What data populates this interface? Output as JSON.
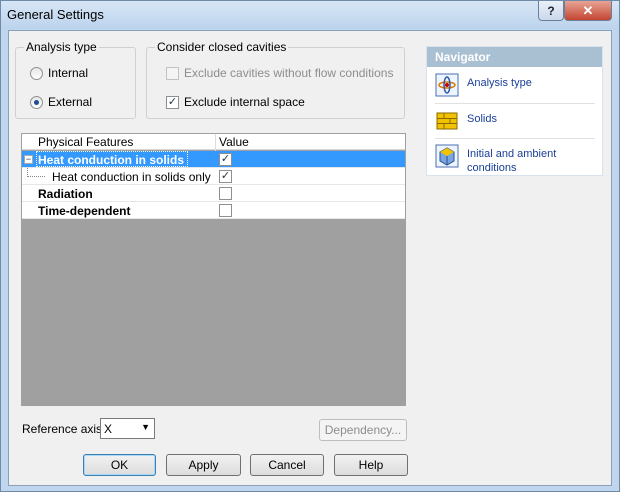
{
  "window": {
    "title": "General Settings"
  },
  "titlebar": {
    "help_label": "?",
    "close_label": "✕"
  },
  "analysis_type": {
    "title": "Analysis type",
    "options": [
      {
        "label": "Internal",
        "selected": false
      },
      {
        "label": "External",
        "selected": true
      }
    ]
  },
  "cavities": {
    "title": "Consider closed cavities",
    "exclude_no_flow": {
      "label": "Exclude cavities without flow conditions",
      "checked": false,
      "enabled": false
    },
    "exclude_internal": {
      "label": "Exclude internal space",
      "checked": true,
      "enabled": true
    }
  },
  "grid": {
    "headers": [
      "Physical Features",
      "Value"
    ],
    "rows": [
      {
        "label": "Heat conduction in solids",
        "checked": true,
        "bold": true,
        "selected": true,
        "expander": "−"
      },
      {
        "label": "Heat conduction in solids only",
        "checked": true,
        "bold": false,
        "selected": false
      },
      {
        "label": "Radiation",
        "checked": false,
        "bold": true,
        "selected": false
      },
      {
        "label": "Time-dependent",
        "checked": false,
        "bold": true,
        "selected": false
      }
    ]
  },
  "reference_axis": {
    "label": "Reference axis:",
    "value": "X"
  },
  "dependency_button": "Dependency...",
  "buttons": {
    "ok": "OK",
    "apply": "Apply",
    "cancel": "Cancel",
    "help": "Help"
  },
  "navigator": {
    "title": "Navigator",
    "items": [
      {
        "label": "Analysis type",
        "icon": "analysis-type-icon"
      },
      {
        "label": "Solids",
        "icon": "solids-icon"
      },
      {
        "label": "Initial and ambient conditions",
        "icon": "initial-conditions-icon"
      }
    ]
  },
  "colors": {
    "selection": "#3399ff",
    "window_frame": "#bfd6ee",
    "navigator_header": "#a9c0d3",
    "link": "#1a3f97"
  }
}
